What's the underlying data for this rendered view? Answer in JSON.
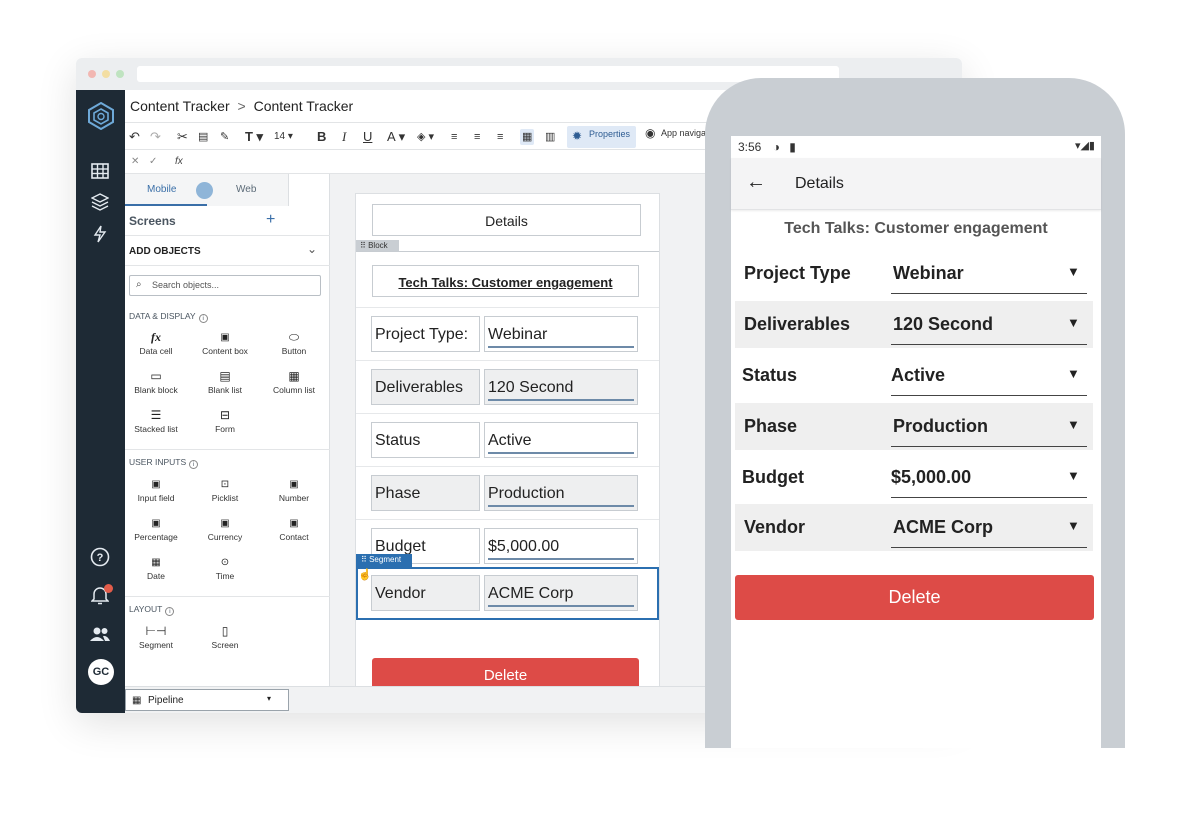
{
  "colors": {
    "accent": "#3a6fa8",
    "nav_dark": "#1e2a35",
    "delete_red": "#dd4b47",
    "segment_blue": "#2b6fb0"
  },
  "breadcrumb": {
    "items": [
      "Content Tracker",
      "Content Tracker"
    ],
    "separator": ">"
  },
  "toolbar": {
    "font_size": "14",
    "properties_label": "Properties",
    "app_nav_label": "App naviga"
  },
  "formula_bar": {
    "fx": "fx"
  },
  "panel": {
    "tabs": {
      "mobile": "Mobile",
      "web": "Web"
    },
    "screens_label": "Screens",
    "add_objects_label": "ADD OBJECTS",
    "search_placeholder": "Search objects...",
    "sections": {
      "data_display": "DATA & DISPLAY",
      "user_inputs": "USER INPUTS",
      "layout": "LAYOUT"
    },
    "data_display_items": [
      "Data cell",
      "Content box",
      "Button",
      "Blank block",
      "Blank list",
      "Column list",
      "Stacked list",
      "Form"
    ],
    "user_input_items": [
      "Input field",
      "Picklist",
      "Number",
      "Percentage",
      "Currency",
      "Contact",
      "Date",
      "Time"
    ],
    "layout_items": [
      "Segment",
      "Screen"
    ]
  },
  "pipeline": {
    "label": "Pipeline"
  },
  "canvas": {
    "header": "Details",
    "block_tag": "Block",
    "title": "Tech Talks: Customer engagement",
    "segment_tag": "Segment",
    "fields": [
      {
        "label": "Project Type:",
        "value": "Webinar"
      },
      {
        "label": "Deliverables",
        "value": "120 Second"
      },
      {
        "label": "Status",
        "value": "Active"
      },
      {
        "label": "Phase",
        "value": "Production"
      },
      {
        "label": "Budget",
        "value": "$5,000.00"
      },
      {
        "label": "Vendor",
        "value": "ACME Corp"
      }
    ],
    "delete_label": "Delete"
  },
  "phone": {
    "time": "3:56",
    "screen_title": "Details",
    "title": "Tech Talks: Customer engagement",
    "fields": [
      {
        "label": "Project Type",
        "value": "Webinar"
      },
      {
        "label": "Deliverables",
        "value": "120 Second"
      },
      {
        "label": "Status",
        "value": "Active"
      },
      {
        "label": "Phase",
        "value": "Production"
      },
      {
        "label": "Budget",
        "value": "$5,000.00"
      },
      {
        "label": "Vendor",
        "value": "ACME Corp"
      }
    ],
    "delete_label": "Delete"
  },
  "user": {
    "initials": "GC"
  }
}
